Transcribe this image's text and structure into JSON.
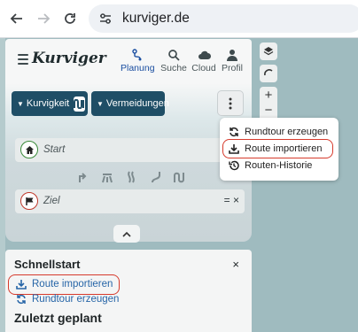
{
  "browser": {
    "url": "kurviger.de",
    "back_icon": "arrow-left-icon",
    "forward_icon": "arrow-right-icon",
    "reload_icon": "reload-icon",
    "site_info_icon": "tune-icon"
  },
  "app": {
    "logo": "Kurviger",
    "tabs": [
      {
        "label": "Planung",
        "icon": "route-icon",
        "active": true
      },
      {
        "label": "Suche",
        "icon": "search-icon",
        "active": false
      },
      {
        "label": "Cloud",
        "icon": "cloud-icon",
        "active": false
      },
      {
        "label": "Profil",
        "icon": "person-icon",
        "active": false
      }
    ],
    "toolbar": {
      "curviness_label": "Kurvigkeit",
      "avoid_label": "Vermeidungen"
    },
    "waypoints": {
      "start_placeholder": "Start",
      "end_placeholder": "Ziel",
      "end_actions": "= ×"
    },
    "accent": "#1a4ea0"
  },
  "dropdown": {
    "items": [
      {
        "label": "Rundtour erzeugen",
        "icon": "loop-icon"
      },
      {
        "label": "Route importieren",
        "icon": "download-icon",
        "highlighted": true
      },
      {
        "label": "Routen-Historie",
        "icon": "history-icon"
      }
    ]
  },
  "map_controls": {
    "layers_icon": "layers-icon",
    "compass_icon": "compass-icon",
    "zoom_in": "+",
    "zoom_out": "−"
  },
  "quickstart": {
    "title": "Schnellstart",
    "close": "×",
    "import_label": "Route importieren",
    "roundtrip_label": "Rundtour erzeugen",
    "recent_title": "Zuletzt geplant"
  },
  "colors": {
    "highlight_ring": "#d63a2c",
    "button_dark": "#1f4e66",
    "link": "#2665a7"
  }
}
